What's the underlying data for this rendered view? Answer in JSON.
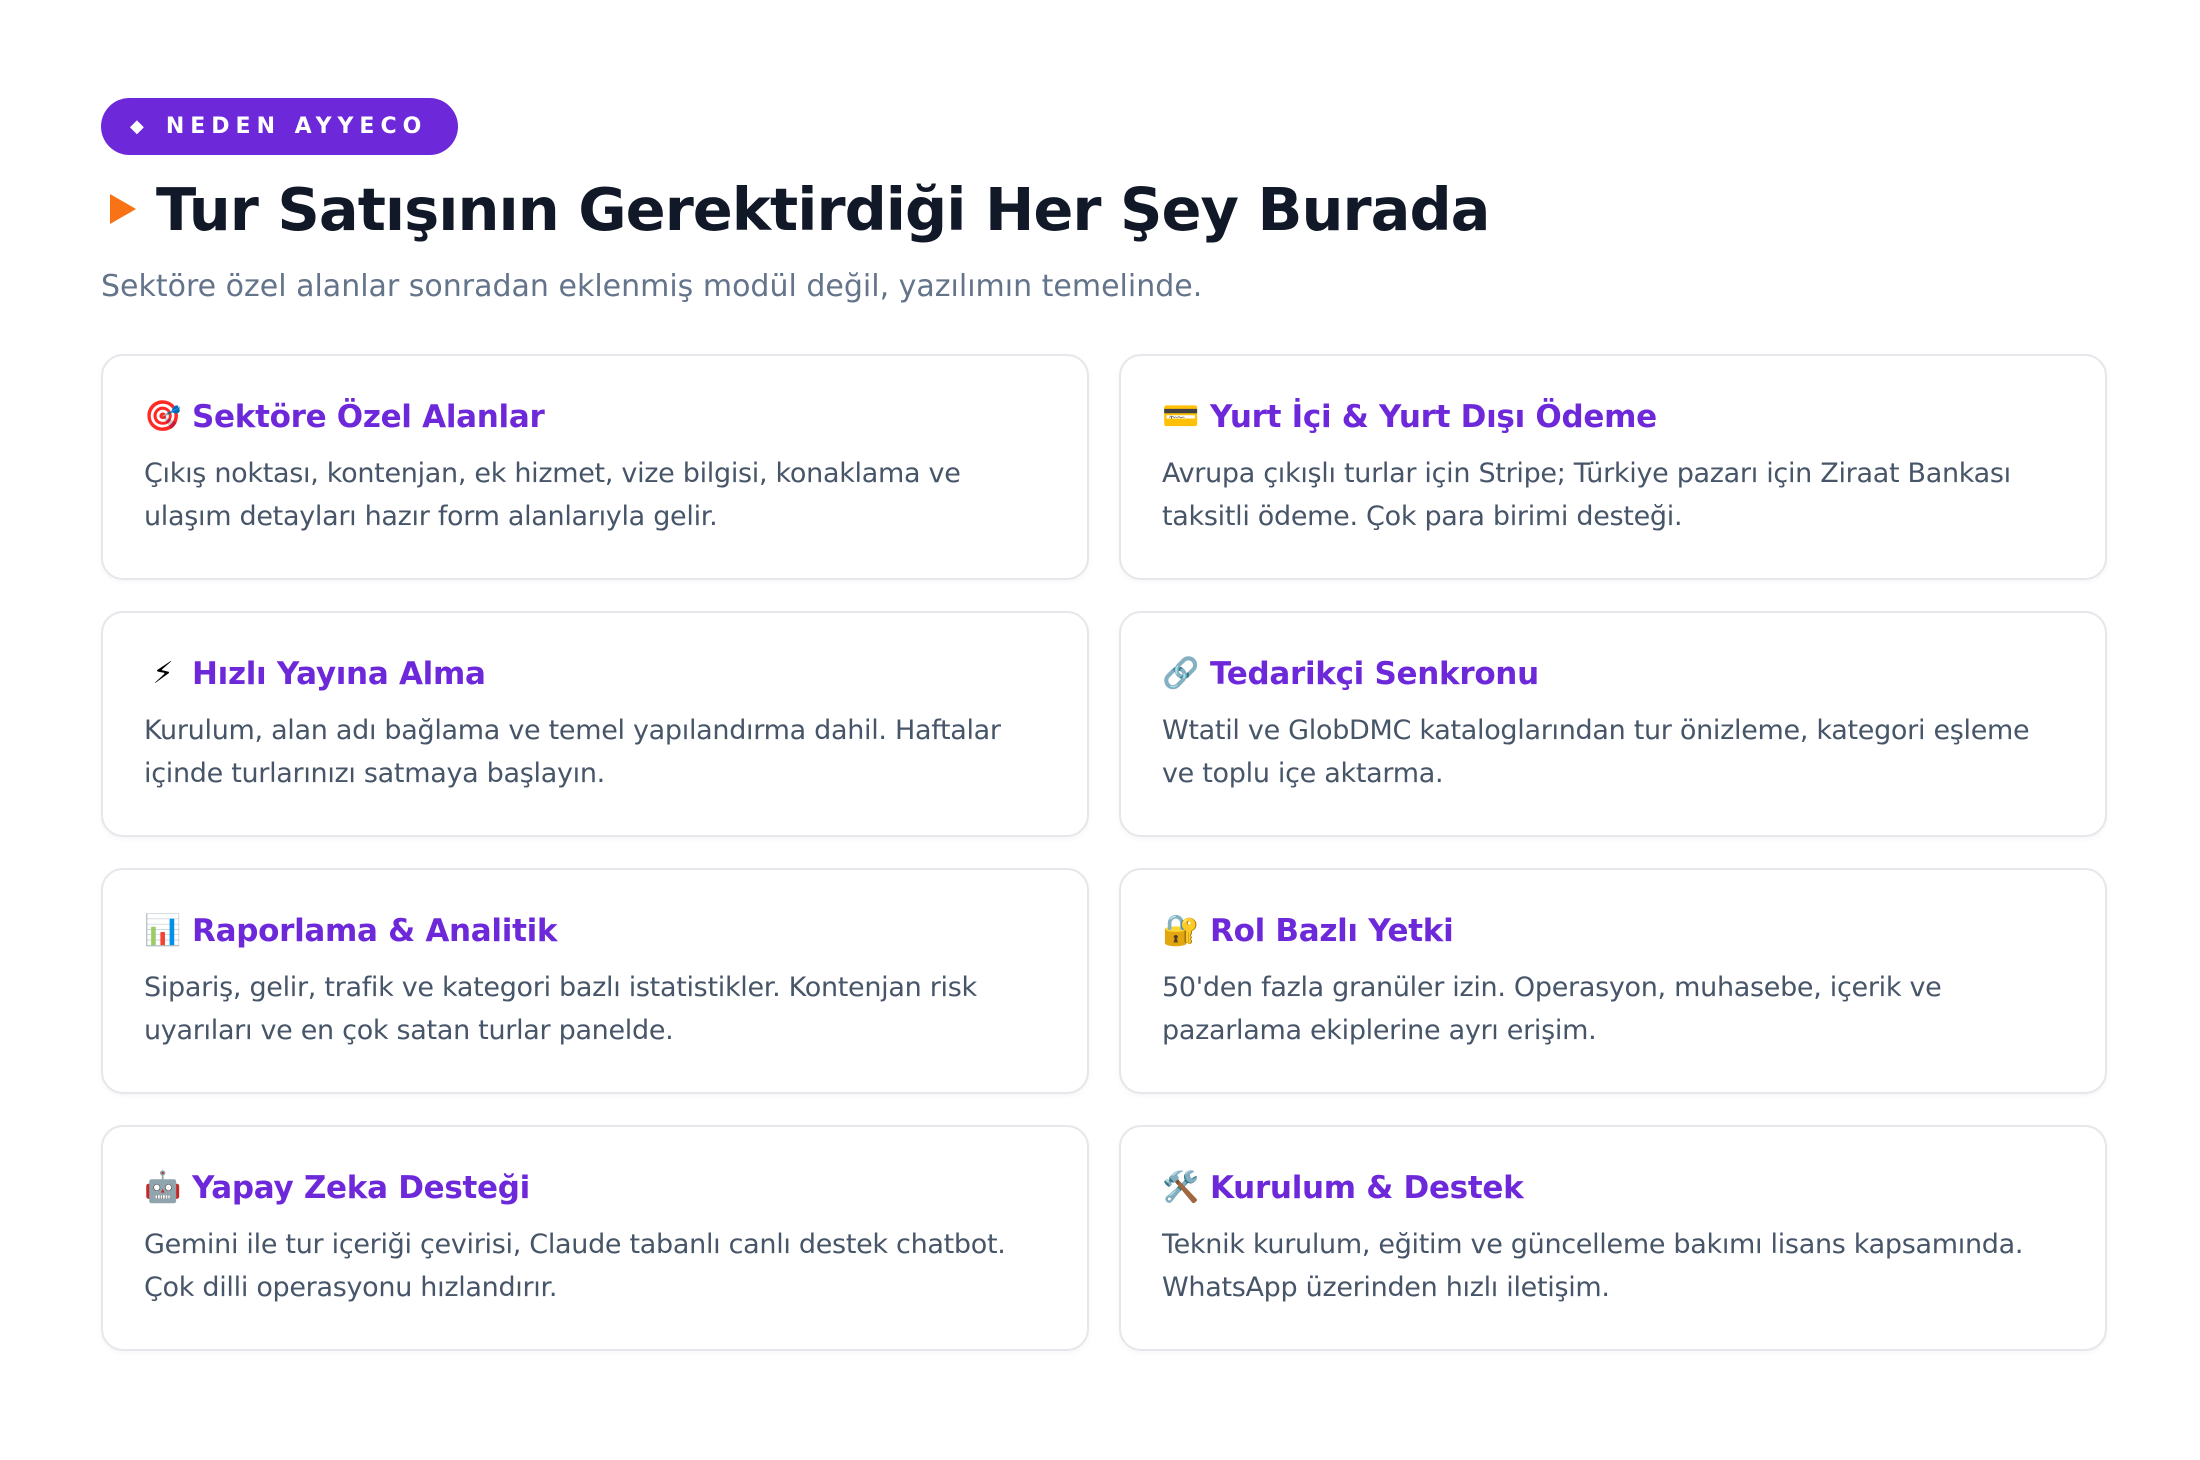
{
  "header": {
    "badge_icon": "◆",
    "badge_label": "NEDEN AYYECO",
    "title": "Tur Satışının Gerektirdiği Her Şey Burada",
    "subtitle": "Sektöre özel alanlar sonradan eklenmiş modül değil, yazılımın temelinde."
  },
  "colors": {
    "accent": "#6d28d9",
    "arrow": "#f97316",
    "title": "#111827",
    "muted": "#64748b",
    "body": "#475569",
    "border": "#e5e7eb"
  },
  "features": [
    {
      "icon": "🎯",
      "icon_name": "target-icon",
      "title": "Sektöre Özel Alanlar",
      "description": "Çıkış noktası, kontenjan, ek hizmet, vize bilgisi, konaklama ve ulaşım detayları hazır form alanlarıyla gelir."
    },
    {
      "icon": "💳",
      "icon_name": "credit-card-icon",
      "title": "Yurt İçi & Yurt Dışı Ödeme",
      "description": "Avrupa çıkışlı turlar için Stripe; Türkiye pazarı için Ziraat Bankası taksitli ödeme. Çok para birimi desteği."
    },
    {
      "icon": "⚡",
      "icon_name": "lightning-icon",
      "title": "Hızlı Yayına Alma",
      "description": "Kurulum, alan adı bağlama ve temel yapılandırma dahil. Haftalar içinde turlarınızı satmaya başlayın."
    },
    {
      "icon": "🔗",
      "icon_name": "link-icon",
      "title": "Tedarikçi Senkronu",
      "description": "Wtatil ve GlobDMC kataloglarından tur önizleme, kategori eşleme ve toplu içe aktarma."
    },
    {
      "icon": "📊",
      "icon_name": "bar-chart-icon",
      "title": "Raporlama & Analitik",
      "description": "Sipariş, gelir, trafik ve kategori bazlı istatistikler. Kontenjan risk uyarıları ve en çok satan turlar panelde."
    },
    {
      "icon": "🔐",
      "icon_name": "lock-key-icon",
      "title": "Rol Bazlı Yetki",
      "description": "50'den fazla granüler izin. Operasyon, muhasebe, içerik ve pazarlama ekiplerine ayrı erişim."
    },
    {
      "icon": "🤖",
      "icon_name": "robot-icon",
      "title": "Yapay Zeka Desteği",
      "description": "Gemini ile tur içeriği çevirisi, Claude tabanlı canlı destek chatbot. Çok dilli operasyonu hızlandırır."
    },
    {
      "icon": "🛠️",
      "icon_name": "tools-icon",
      "title": "Kurulum & Destek",
      "description": "Teknik kurulum, eğitim ve güncelleme bakımı lisans kapsamında. WhatsApp üzerinden hızlı iletişim."
    }
  ]
}
